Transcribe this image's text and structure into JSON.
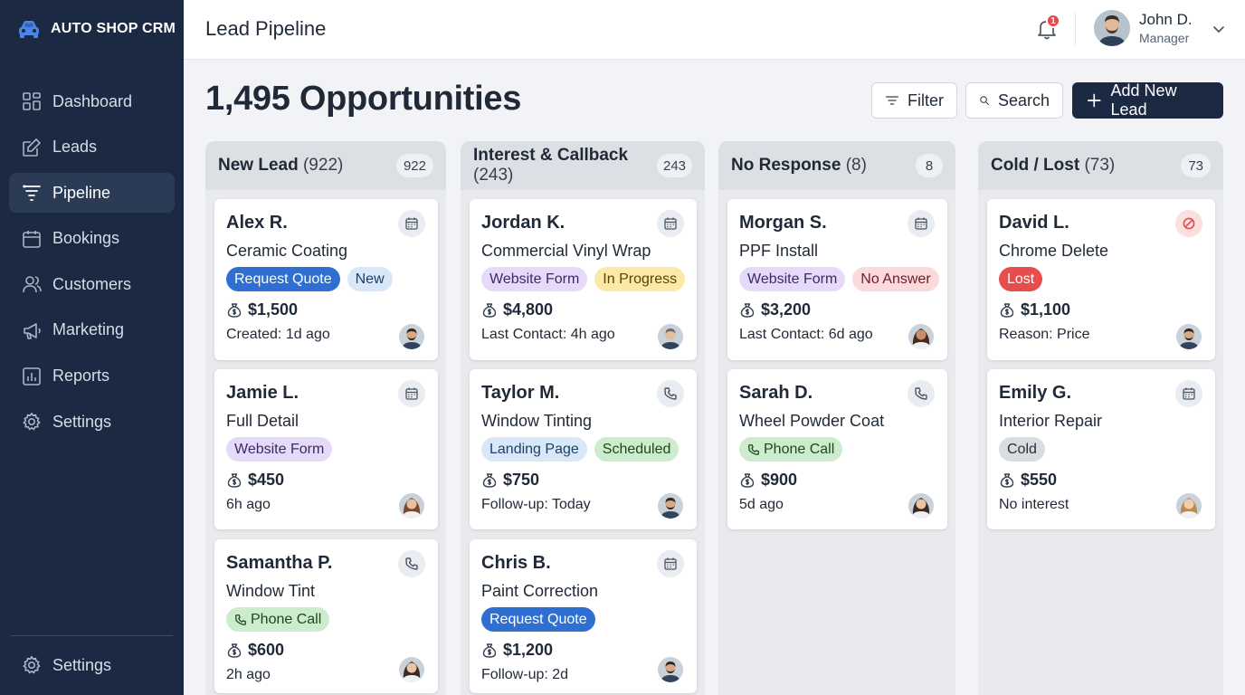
{
  "brand": {
    "name": "AUTO SHOP CRM"
  },
  "sidebar": {
    "items": [
      {
        "label": "Dashboard",
        "icon": "dashboard-icon"
      },
      {
        "label": "Leads",
        "icon": "edit-icon"
      },
      {
        "label": "Pipeline",
        "icon": "filter-icon",
        "active": true
      },
      {
        "label": "Bookings",
        "icon": "calendar-icon"
      },
      {
        "label": "Customers",
        "icon": "users-icon"
      },
      {
        "label": "Marketing",
        "icon": "megaphone-icon"
      },
      {
        "label": "Reports",
        "icon": "chart-icon"
      },
      {
        "label": "Settings",
        "icon": "gear-icon"
      }
    ],
    "bottom": {
      "label": "Settings",
      "icon": "gear-icon"
    }
  },
  "header": {
    "title": "Lead Pipeline",
    "notifications": "1",
    "user": {
      "name": "John D.",
      "role": "Manager"
    }
  },
  "main": {
    "title": "1,495 Opportunities",
    "actions": {
      "filter": "Filter",
      "search": "Search",
      "add": "Add New Lead"
    }
  },
  "columns": [
    {
      "title": "New Lead",
      "count_label": "(922)",
      "badge": "922",
      "cards": [
        {
          "name": "Alex R.",
          "service": "Ceramic Coating",
          "icon": "calendar-icon",
          "tags": [
            {
              "text": "Request Quote",
              "style": "t-blue"
            },
            {
              "text": "New",
              "style": "t-lightblue"
            }
          ],
          "amount": "$1,500",
          "meta": "Created: 1d ago",
          "avatar": "man-dark-beard"
        },
        {
          "name": "Jamie L.",
          "service": "Full Detail",
          "icon": "calendar-icon",
          "tags": [
            {
              "text": "Website Form",
              "style": "t-purple"
            }
          ],
          "amount": "$450",
          "meta": "6h ago",
          "avatar": "woman-brown-hair"
        },
        {
          "name": "Samantha P.",
          "service": "Window Tint",
          "icon": "phone-icon",
          "tags": [
            {
              "text": "Phone Call",
              "style": "t-green",
              "phone": true
            }
          ],
          "amount": "$600",
          "meta": "2h ago",
          "avatar": "woman-dark-hair"
        }
      ]
    },
    {
      "title": "Interest & Callback",
      "count_label": "(243)",
      "badge": "243",
      "cards": [
        {
          "name": "Jordan K.",
          "service": "Commercial Vinyl Wrap",
          "icon": "calendar-icon",
          "tags": [
            {
              "text": "Website Form",
              "style": "t-purple"
            },
            {
              "text": "In Progress",
              "style": "t-yellow"
            }
          ],
          "amount": "$4,800",
          "meta": "Last Contact: 4h ago",
          "avatar": "man-grey"
        },
        {
          "name": "Taylor M.",
          "service": "Window Tinting",
          "icon": "phone-icon",
          "tags": [
            {
              "text": "Landing Page",
              "style": "t-lightblue"
            },
            {
              "text": "Scheduled",
              "style": "t-green"
            }
          ],
          "amount": "$750",
          "meta": "Follow-up: Today",
          "avatar": "man-dark-beard"
        },
        {
          "name": "Chris B.",
          "service": "Paint Correction",
          "icon": "calendar-icon",
          "tags": [
            {
              "text": "Request Quote",
              "style": "t-blue"
            }
          ],
          "amount": "$1,200",
          "meta": "Follow-up: 2d",
          "avatar": "man-dark-beard"
        }
      ]
    },
    {
      "title": "No Response",
      "count_label": "(8)",
      "badge": "8",
      "cards": [
        {
          "name": "Morgan S.",
          "service": "PPF Install",
          "icon": "calendar-icon",
          "tags": [
            {
              "text": "Website Form",
              "style": "t-purple"
            },
            {
              "text": "No Answer",
              "style": "t-pink"
            }
          ],
          "amount": "$3,200",
          "meta": "Last Contact: 6d ago",
          "avatar": "woman-curly"
        },
        {
          "name": "Sarah D.",
          "service": "Wheel Powder Coat",
          "icon": "phone-icon",
          "tags": [
            {
              "text": "Phone Call",
              "style": "t-green",
              "phone": true
            }
          ],
          "amount": "$900",
          "meta": "5d ago",
          "avatar": "woman-dark-hair"
        }
      ]
    },
    {
      "title": "Cold / Lost",
      "count_label": "(73)",
      "badge": "73",
      "cards": [
        {
          "name": "David L.",
          "service": "Chrome Delete",
          "icon": "ban-icon",
          "tags": [
            {
              "text": "Lost",
              "style": "t-red"
            }
          ],
          "amount": "$1,100",
          "meta": "Reason: Price",
          "avatar": "man-dark-beard"
        },
        {
          "name": "Emily G.",
          "service": "Interior Repair",
          "icon": "calendar-icon",
          "tags": [
            {
              "text": "Cold",
              "style": "t-grey"
            }
          ],
          "amount": "$550",
          "meta": "No interest",
          "avatar": "woman-blonde"
        }
      ]
    }
  ]
}
